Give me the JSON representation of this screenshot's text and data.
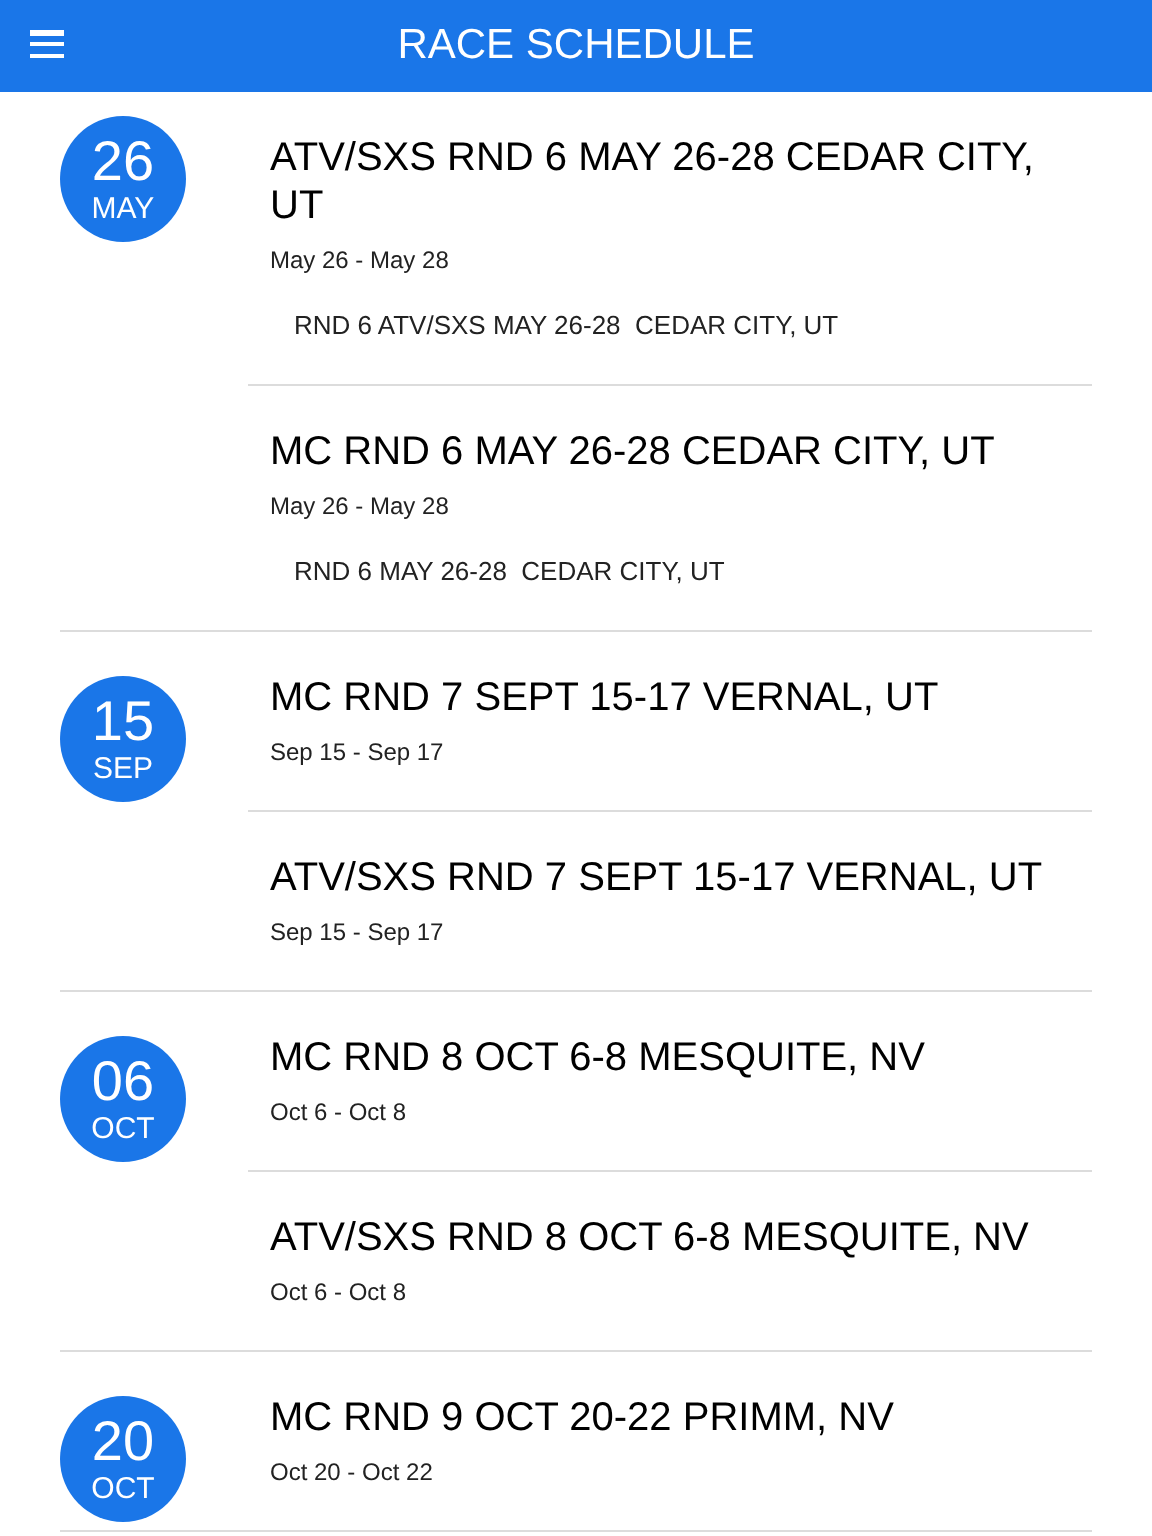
{
  "header": {
    "title": "RACE SCHEDULE"
  },
  "groups": [
    {
      "day": "26",
      "month": "MAY",
      "events": [
        {
          "title": "ATV/SXS RND 6 MAY 26-28 CEDAR CITY, UT",
          "dates": "May 26 - May 28",
          "description": "RND 6 ATV/SXS MAY 26-28  CEDAR CITY, UT"
        },
        {
          "title": "MC RND 6 MAY 26-28 CEDAR CITY, UT",
          "dates": "May 26 - May 28",
          "description": "RND 6 MAY 26-28  CEDAR CITY, UT"
        }
      ]
    },
    {
      "day": "15",
      "month": "SEP",
      "events": [
        {
          "title": "MC RND 7 SEPT 15-17 VERNAL, UT",
          "dates": "Sep 15 - Sep 17"
        },
        {
          "title": "ATV/SXS RND 7 SEPT 15-17 VERNAL, UT",
          "dates": "Sep 15 - Sep 17"
        }
      ]
    },
    {
      "day": "06",
      "month": "OCT",
      "events": [
        {
          "title": "MC RND 8 OCT 6-8 MESQUITE, NV",
          "dates": "Oct 6 - Oct 8"
        },
        {
          "title": "ATV/SXS RND 8 OCT 6-8 MESQUITE, NV",
          "dates": "Oct 6 - Oct 8"
        }
      ]
    },
    {
      "day": "20",
      "month": "OCT",
      "events": [
        {
          "title": "MC RND 9 OCT 20-22 PRIMM, NV",
          "dates": "Oct 20 - Oct 22"
        }
      ]
    }
  ]
}
